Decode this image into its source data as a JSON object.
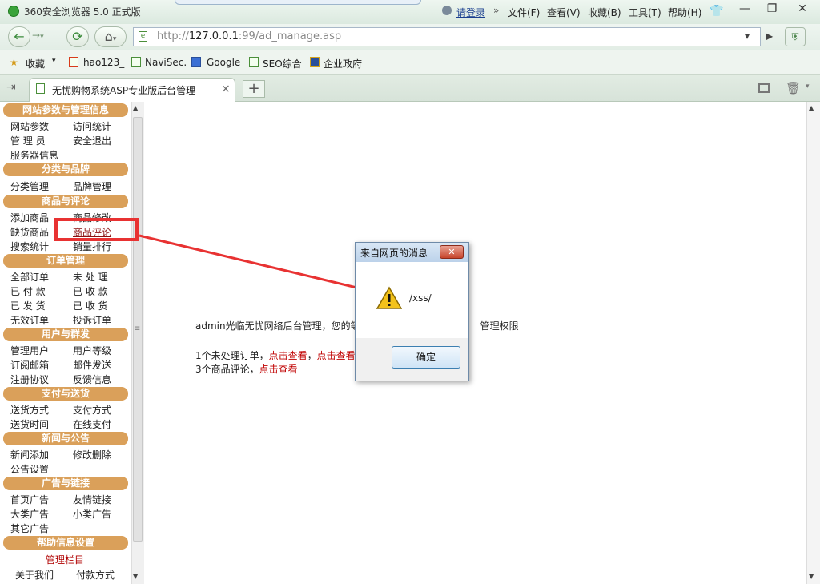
{
  "browser": {
    "title": "360安全浏览器 5.0 正式版",
    "login": "请登录",
    "menu": [
      "文件(F)",
      "查看(V)",
      "收藏(B)",
      "工具(T)",
      "帮助(H)"
    ],
    "window_controls": {
      "minimize": "—",
      "maximize": "❐",
      "close": "✕"
    }
  },
  "address_bar": {
    "url_prefix": "http://",
    "url_host": "127.0.0.1",
    "url_rest": ":99/ad_manage.asp"
  },
  "bookmarks": {
    "favorites_label": "收藏",
    "items": [
      "hao123_",
      "NaviSec.",
      "Google",
      "SEO综合",
      "企业政府"
    ]
  },
  "tabs": {
    "active_title": "无忧购物系统ASP专业版后台管理",
    "new_tab": "+"
  },
  "sidebar": {
    "sections": [
      {
        "title": "网站参数与管理信息",
        "items": [
          "网站参数",
          "访问统计",
          "管 理 员",
          "安全退出",
          "服务器信息"
        ]
      },
      {
        "title": "分类与品牌",
        "items": [
          "分类管理",
          "品牌管理"
        ]
      },
      {
        "title": "商品与评论",
        "items": [
          "添加商品",
          "商品修改",
          "缺货商品",
          "商品评论",
          "搜索统计",
          "销量排行"
        ]
      },
      {
        "title": "订单管理",
        "items": [
          "全部订单",
          "未 处 理",
          "已 付 款",
          "已 收 款",
          "已 发 货",
          "已 收 货",
          "无效订单",
          "投诉订单"
        ]
      },
      {
        "title": "用户与群发",
        "items": [
          "管理用户",
          "用户等级",
          "订阅邮箱",
          "邮件发送",
          "注册协议",
          "反馈信息"
        ]
      },
      {
        "title": "支付与送货",
        "items": [
          "送货方式",
          "支付方式",
          "送货时间",
          "在线支付"
        ]
      },
      {
        "title": "新闻与公告",
        "items": [
          "新闻添加",
          "修改删除",
          "公告设置"
        ]
      },
      {
        "title": "广告与链接",
        "items": [
          "首页广告",
          "友情链接",
          "大类广告",
          "小类广告",
          "其它广告"
        ]
      },
      {
        "title": "帮助信息设置",
        "sub": "管理栏目",
        "items": [
          "关于我们",
          "付款方式"
        ]
      }
    ]
  },
  "main": {
    "welcome_left": "admin光临无忧网络后台管理，您的等",
    "welcome_right": "管理权限",
    "orders_text": "1个未处理订单，",
    "orders_link1": "点击查看",
    "orders_sep": "，",
    "orders_link2": "点击查看",
    "reviews_text": "3个商品评论，",
    "reviews_link": "点击查看"
  },
  "dialog": {
    "title": "来自网页的消息",
    "message": "/xss/",
    "ok_label": "确定"
  },
  "colors": {
    "section_header": "#daa05a",
    "highlight": "#e83232",
    "link_red": "#c00000"
  }
}
